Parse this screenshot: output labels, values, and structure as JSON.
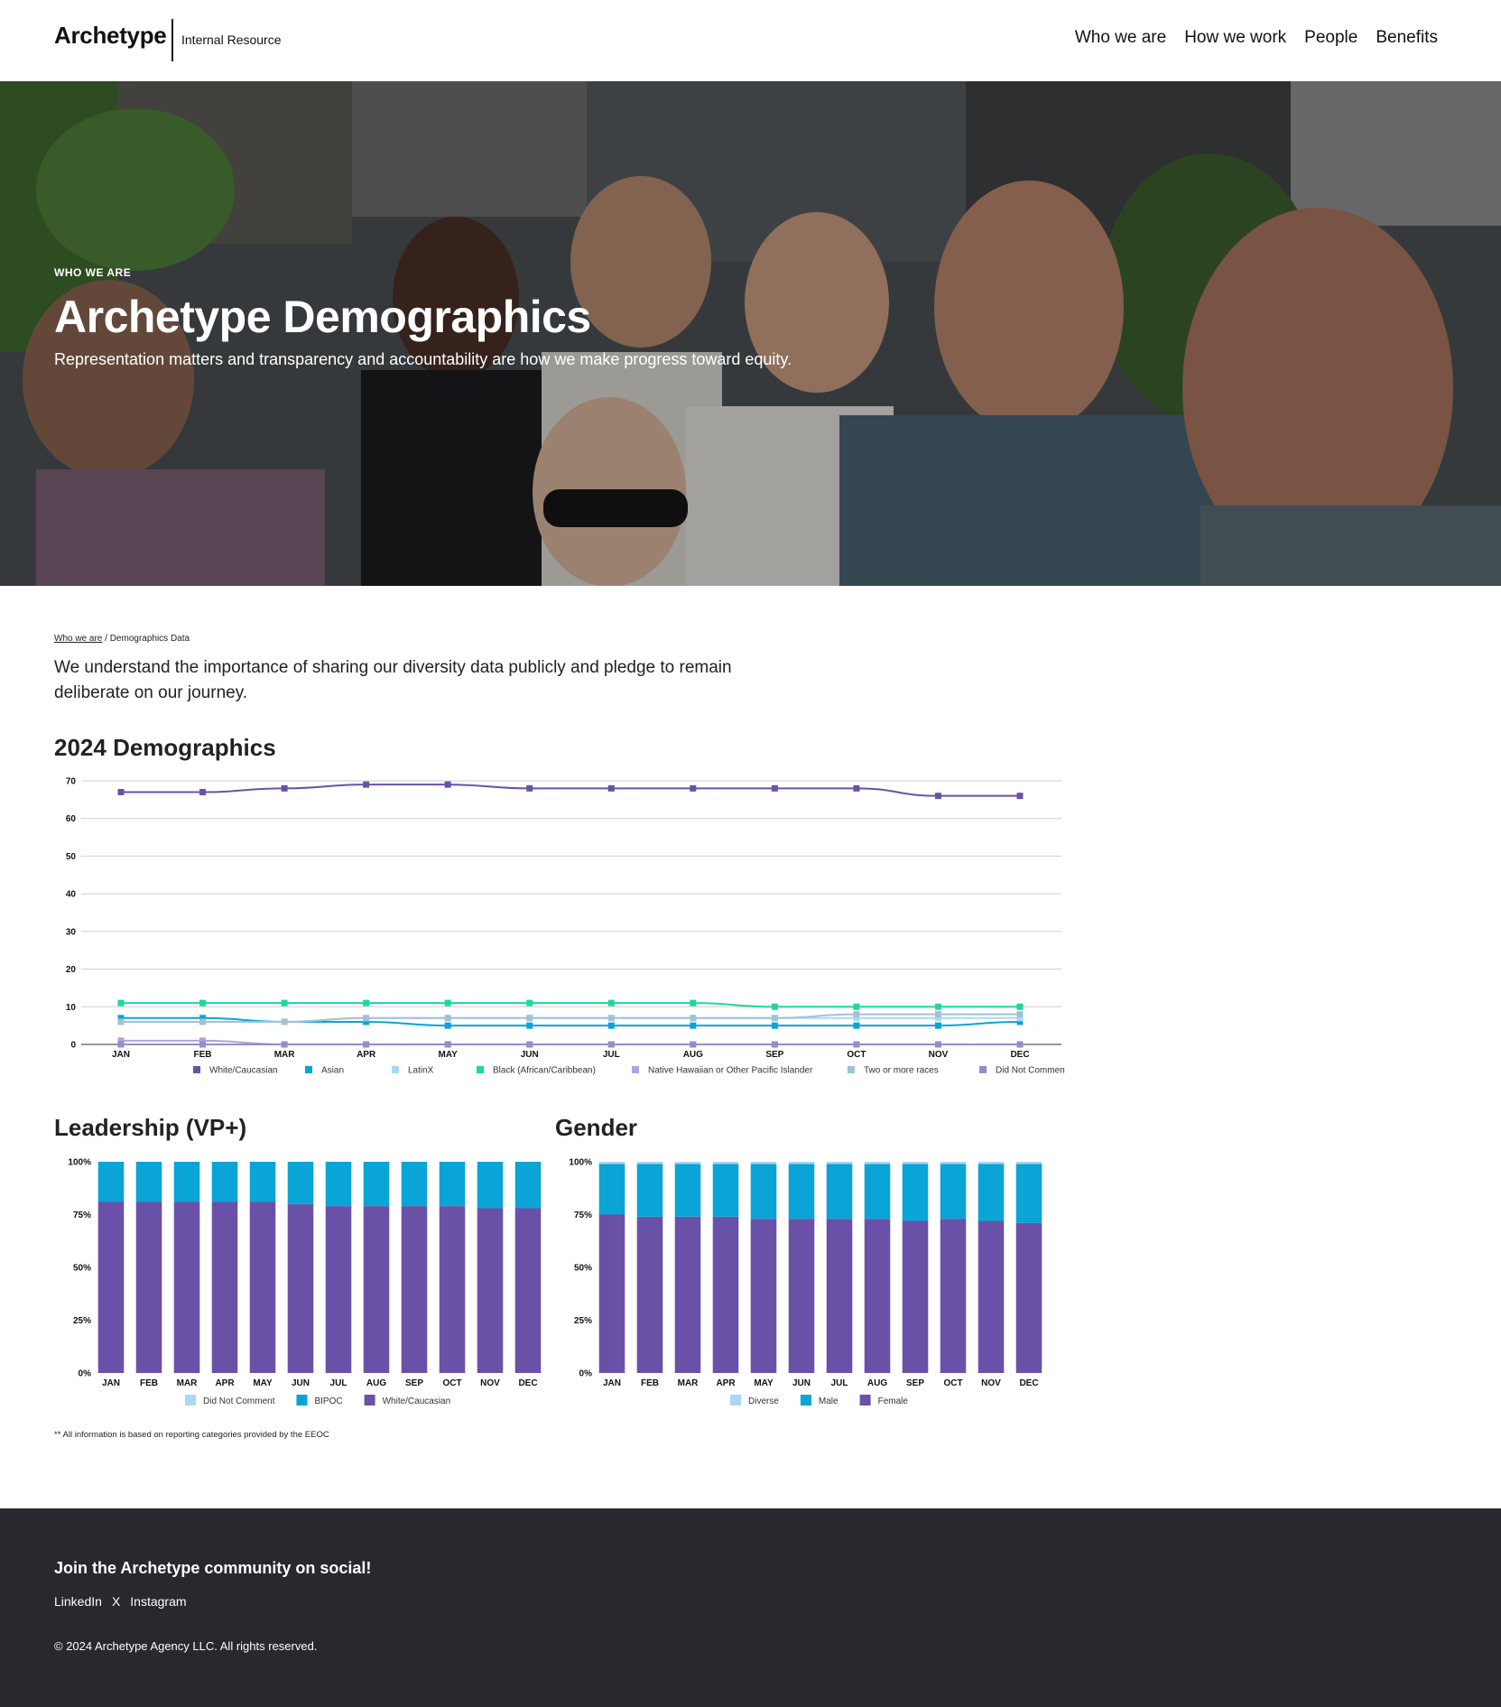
{
  "header": {
    "logo": "Archetype",
    "logo_subtitle": "Internal Resource",
    "nav": [
      "Who we are",
      "How we work",
      "People",
      "Benefits"
    ]
  },
  "hero": {
    "eyebrow": "WHO WE ARE",
    "title": "Archetype Demographics",
    "subtitle": "Representation matters and transparency and accountability are how we make progress toward equity."
  },
  "breadcrumb": {
    "parent": "Who we are",
    "separator": " / ",
    "current": "Demographics Data"
  },
  "intro": "We understand the importance of sharing our diversity data publicly and pledge to remain deliberate on our journey.",
  "sections": {
    "demographics_title": "2024 Demographics",
    "leadership_title": "Leadership (VP+)",
    "gender_title": "Gender"
  },
  "footnote": "** All information is based on reporting categories provided by the EEOC",
  "footer": {
    "title": "Join the Archetype community on social!",
    "links": [
      "LinkedIn",
      "X",
      "Instagram"
    ],
    "copyright": "© 2024 Archetype Agency LLC. All rights reserved."
  },
  "colors": {
    "purple": "#6a51a8",
    "blue": "#0aa4d6",
    "light_blue": "#a9d8f5",
    "teal": "#1fd6a0",
    "lavender": "#b0a3de",
    "grey_blue": "#9fc3d6",
    "mauve": "#9a8ac7"
  },
  "chart_data": [
    {
      "type": "line",
      "categories": [
        "JAN",
        "FEB",
        "MAR",
        "APR",
        "MAY",
        "JUN",
        "JUL",
        "AUG",
        "SEP",
        "OCT",
        "NOV",
        "DEC"
      ],
      "ylim": [
        0,
        70
      ],
      "yticks": [
        "0",
        "10",
        "20",
        "30",
        "40",
        "50",
        "60",
        "70"
      ],
      "grid": true,
      "legend": "bottom",
      "series": [
        {
          "name": "White/Caucasian",
          "color": "#6a51a8",
          "values": [
            67,
            67,
            68,
            69,
            69,
            68,
            68,
            68,
            68,
            68,
            66,
            66
          ]
        },
        {
          "name": "Asian",
          "color": "#0aa4d6",
          "values": [
            7,
            7,
            6,
            6,
            5,
            5,
            5,
            5,
            5,
            5,
            5,
            6
          ]
        },
        {
          "name": "LatinX",
          "color": "#a9d8f5",
          "values": [
            6,
            6,
            6,
            7,
            7,
            7,
            7,
            7,
            7,
            7,
            7,
            7
          ]
        },
        {
          "name": "Black (African/Caribbean)",
          "color": "#1fd6a0",
          "values": [
            11,
            11,
            11,
            11,
            11,
            11,
            11,
            11,
            10,
            10,
            10,
            10
          ]
        },
        {
          "name": "Native Hawaiian or Other Pacific Islander",
          "color": "#b0a3de",
          "values": [
            1,
            1,
            0,
            0,
            0,
            0,
            0,
            0,
            0,
            0,
            0,
            0
          ]
        },
        {
          "name": "Two or more races",
          "color": "#9fc3d6",
          "values": [
            6,
            6,
            6,
            7,
            7,
            7,
            7,
            7,
            7,
            8,
            8,
            8
          ]
        },
        {
          "name": "Did Not Comment",
          "color": "#9a8ac7",
          "values": [
            0,
            0,
            0,
            0,
            0,
            0,
            0,
            0,
            0,
            0,
            0,
            0
          ]
        }
      ]
    },
    {
      "type": "bar",
      "stacked": true,
      "categories": [
        "JAN",
        "FEB",
        "MAR",
        "APR",
        "MAY",
        "JUN",
        "JUL",
        "AUG",
        "SEP",
        "OCT",
        "NOV",
        "DEC"
      ],
      "ylim": [
        0,
        100
      ],
      "yticks": [
        "0%",
        "25%",
        "50%",
        "75%",
        "100%"
      ],
      "legend": "bottom",
      "series": [
        {
          "name": "Did Not Comment",
          "color": "#a9d8f5",
          "values": [
            0,
            0,
            0,
            0,
            0,
            0,
            0,
            0,
            0,
            0,
            0,
            0
          ]
        },
        {
          "name": "BIPOC",
          "color": "#0aa4d6",
          "values": [
            19,
            19,
            19,
            19,
            19,
            20,
            21,
            21,
            21,
            21,
            22,
            22
          ]
        },
        {
          "name": "White/Caucasian",
          "color": "#6a51a8",
          "values": [
            81,
            81,
            81,
            81,
            81,
            80,
            79,
            79,
            79,
            79,
            78,
            78
          ]
        }
      ]
    },
    {
      "type": "bar",
      "stacked": true,
      "categories": [
        "JAN",
        "FEB",
        "MAR",
        "APR",
        "MAY",
        "JUN",
        "JUL",
        "AUG",
        "SEP",
        "OCT",
        "NOV",
        "DEC"
      ],
      "ylim": [
        0,
        100
      ],
      "yticks": [
        "0%",
        "25%",
        "50%",
        "75%",
        "100%"
      ],
      "legend": "bottom",
      "series": [
        {
          "name": "Diverse",
          "color": "#a9d8f5",
          "values": [
            1,
            1,
            1,
            1,
            1,
            1,
            1,
            1,
            1,
            1,
            1,
            1
          ]
        },
        {
          "name": "Male",
          "color": "#0aa4d6",
          "values": [
            24,
            25,
            25,
            25,
            26,
            26,
            26,
            26,
            27,
            26,
            27,
            28
          ]
        },
        {
          "name": "Female",
          "color": "#6a51a8",
          "values": [
            75,
            74,
            74,
            74,
            73,
            73,
            73,
            73,
            72,
            73,
            72,
            71
          ]
        }
      ]
    }
  ]
}
